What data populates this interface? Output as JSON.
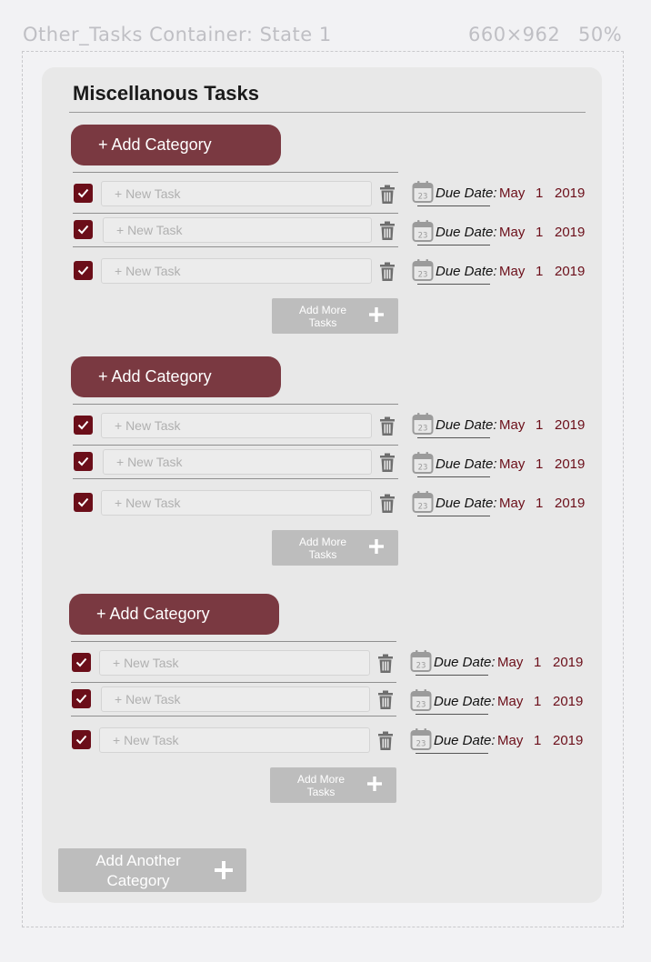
{
  "header": {
    "container_name": "Other_Tasks Container: State 1",
    "dimensions": "660×962",
    "zoom": "50%"
  },
  "title": "Miscellanous Tasks",
  "add_category_label": "+ Add Category",
  "task_placeholder": "+ New Task",
  "due_label": "Due Date:",
  "calendar_day": "23",
  "add_more_label": "Add More Tasks",
  "add_more_line1": "Add More",
  "add_more_line2": "Tasks",
  "add_another_line1": "Add Another",
  "add_another_line2": "Category",
  "sections": [
    {
      "tasks": [
        {
          "checked": true,
          "placeholder": "+ New Task",
          "due_month": "May",
          "due_day": "1",
          "due_year": "2019"
        },
        {
          "checked": true,
          "placeholder": "+ New Task",
          "due_month": "May",
          "due_day": "1",
          "due_year": "2019"
        },
        {
          "checked": true,
          "placeholder": "+ New Task",
          "due_month": "May",
          "due_day": "1",
          "due_year": "2019"
        }
      ]
    },
    {
      "tasks": [
        {
          "checked": true,
          "placeholder": "+ New Task",
          "due_month": "May",
          "due_day": "1",
          "due_year": "2019"
        },
        {
          "checked": true,
          "placeholder": "+ New Task",
          "due_month": "May",
          "due_day": "1",
          "due_year": "2019"
        },
        {
          "checked": true,
          "placeholder": "+ New Task",
          "due_month": "May",
          "due_day": "1",
          "due_year": "2019"
        }
      ]
    },
    {
      "tasks": [
        {
          "checked": true,
          "placeholder": "+ New Task",
          "due_month": "May",
          "due_day": "1",
          "due_year": "2019"
        },
        {
          "checked": true,
          "placeholder": "+ New Task",
          "due_month": "May",
          "due_day": "1",
          "due_year": "2019"
        },
        {
          "checked": true,
          "placeholder": "+ New Task",
          "due_month": "May",
          "due_day": "1",
          "due_year": "2019"
        }
      ]
    }
  ],
  "colors": {
    "accent": "#7a3941",
    "checkbox": "#6b0e19",
    "date_text": "#6b0e19",
    "card_bg": "#e8e8e8",
    "button_gray": "#bdbdbd"
  }
}
